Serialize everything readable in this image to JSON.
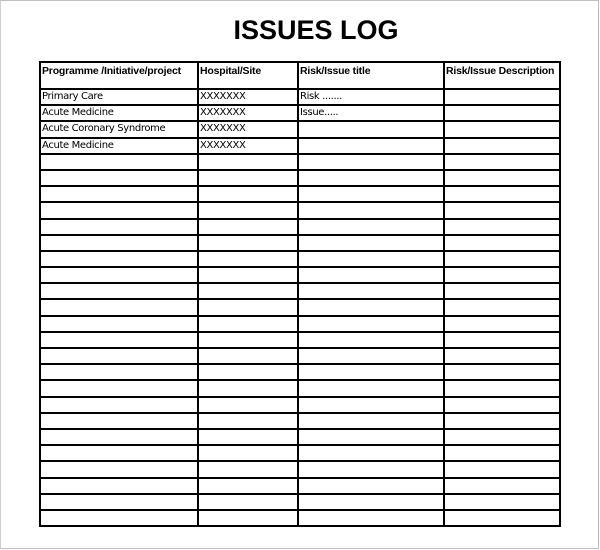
{
  "document": {
    "title": "ISSUES LOG"
  },
  "table": {
    "headers": [
      "Programme /Initiative/project",
      "Hospital/Site",
      "Risk/Issue title",
      "Risk/Issue Description"
    ],
    "rows": [
      [
        "Primary Care",
        "XXXXXXX",
        "Risk .......",
        ""
      ],
      [
        "Acute Medicine",
        "XXXXXXX",
        "Issue.....",
        ""
      ],
      [
        "Acute Coronary Syndrome",
        "XXXXXXX",
        "",
        ""
      ],
      [
        "Acute Medicine",
        "XXXXXXX",
        "",
        ""
      ],
      [
        "",
        "",
        "",
        ""
      ],
      [
        "",
        "",
        "",
        ""
      ],
      [
        "",
        "",
        "",
        ""
      ],
      [
        "",
        "",
        "",
        ""
      ],
      [
        "",
        "",
        "",
        ""
      ],
      [
        "",
        "",
        "",
        ""
      ],
      [
        "",
        "",
        "",
        ""
      ],
      [
        "",
        "",
        "",
        ""
      ],
      [
        "",
        "",
        "",
        ""
      ],
      [
        "",
        "",
        "",
        ""
      ],
      [
        "",
        "",
        "",
        ""
      ],
      [
        "",
        "",
        "",
        ""
      ],
      [
        "",
        "",
        "",
        ""
      ],
      [
        "",
        "",
        "",
        ""
      ],
      [
        "",
        "",
        "",
        ""
      ],
      [
        "",
        "",
        "",
        ""
      ],
      [
        "",
        "",
        "",
        ""
      ],
      [
        "",
        "",
        "",
        ""
      ],
      [
        "",
        "",
        "",
        ""
      ],
      [
        "",
        "",
        "",
        ""
      ],
      [
        "",
        "",
        "",
        ""
      ],
      [
        "",
        "",
        "",
        ""
      ],
      [
        "",
        "",
        "",
        ""
      ]
    ]
  }
}
